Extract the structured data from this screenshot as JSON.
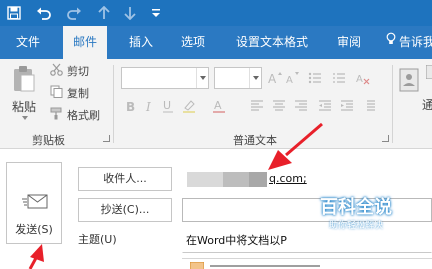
{
  "ribbon_tabs": {
    "file": "文件",
    "mail": "邮件",
    "insert": "插入",
    "options": "选项",
    "format_text": "设置文本格式",
    "review": "审阅",
    "tell_me": "告诉我"
  },
  "ribbon": {
    "paste": "粘贴",
    "cut": "剪切",
    "copy": "复制",
    "format_painter": "格式刷",
    "clipboard_group": "剪贴板",
    "basic_text_group": "普通文本",
    "cut_icon": "scissors-icon",
    "copy_icon": "copy-icon",
    "format_painter_icon": "paintbrush-icon",
    "paste_icon": "clipboard-icon",
    "partial_right_label": "通"
  },
  "compose": {
    "send_label": "发送(S)",
    "to_button": "收件人...",
    "cc_button": "抄送(C)...",
    "subject_label": "主题(U)",
    "to_value_suffix": "q.com;",
    "subject_value": "在Word中将文档以P"
  },
  "watermark": {
    "title": "百科全说",
    "subtitle": "助你轻松解决"
  },
  "colors": {
    "title_bar": "#1e73be",
    "tab_bar": "#2b79c2",
    "ribbon_bg": "#f3f3f3",
    "annotation": "#e8202a"
  }
}
